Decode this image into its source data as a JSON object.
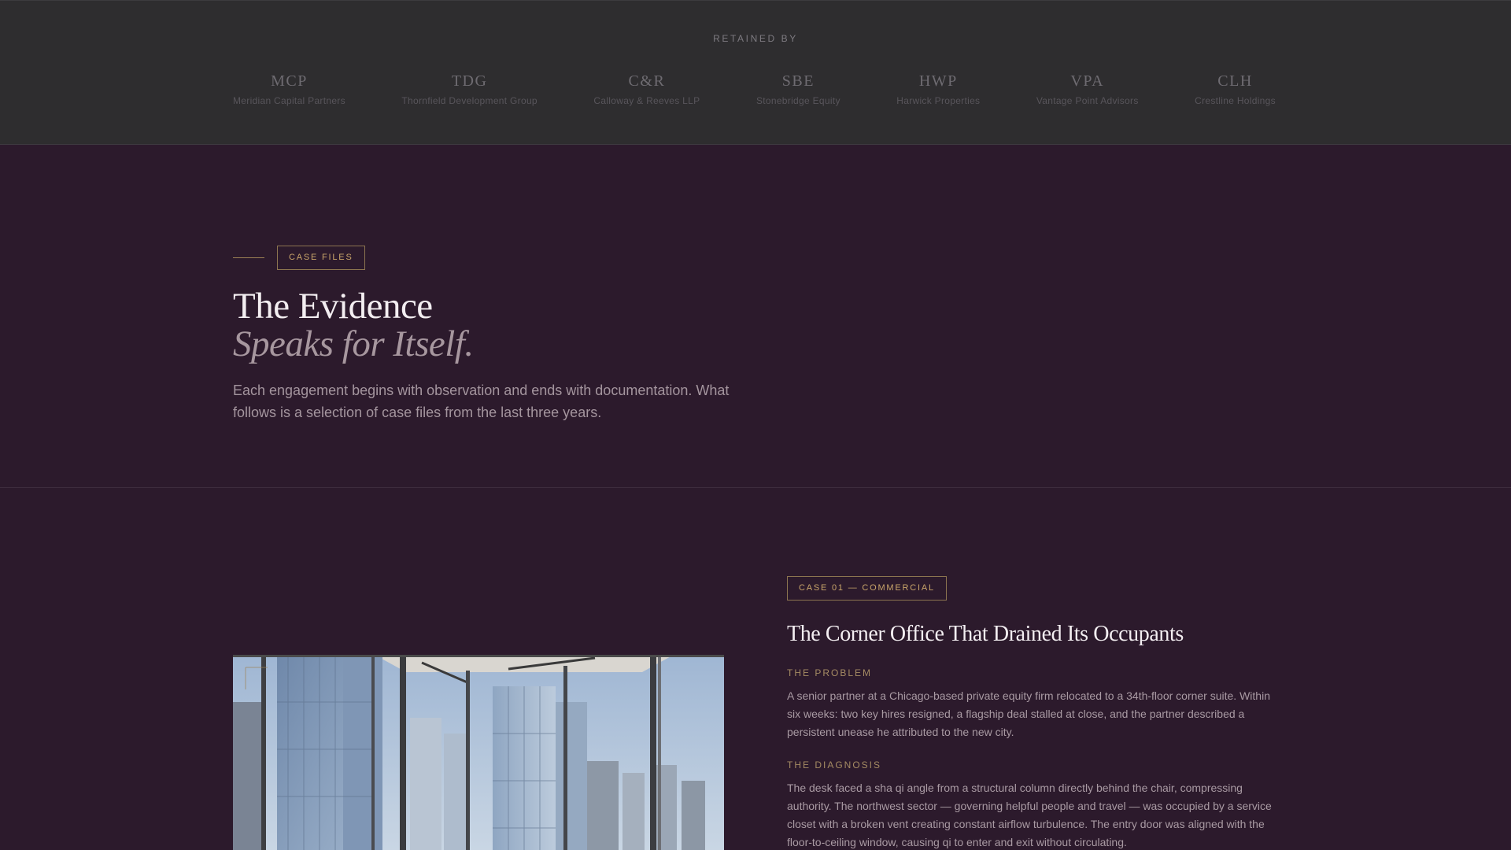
{
  "retained": {
    "label": "RETAINED BY",
    "clients": [
      {
        "abbr": "MCP",
        "name": "Meridian Capital Partners"
      },
      {
        "abbr": "TDG",
        "name": "Thornfield Development Group"
      },
      {
        "abbr": "C&R",
        "name": "Calloway & Reeves LLP"
      },
      {
        "abbr": "SBE",
        "name": "Stonebridge Equity"
      },
      {
        "abbr": "HWP",
        "name": "Harwick Properties"
      },
      {
        "abbr": "VPA",
        "name": "Vantage Point Advisors"
      },
      {
        "abbr": "CLH",
        "name": "Crestline Holdings"
      }
    ]
  },
  "intro": {
    "tag": "CASE FILES",
    "title": "The Evidence",
    "subtitle": "Speaks for Itself.",
    "description": "Each engagement begins with observation and ends with documentation. What follows is a selection of case files from the last three years."
  },
  "case01": {
    "tag": "CASE 01 — COMMERCIAL",
    "title": "The Corner Office That Drained Its Occupants",
    "problem_label": "THE PROBLEM",
    "problem_text": "A senior partner at a Chicago-based private equity firm relocated to a 34th-floor corner suite. Within six weeks: two key hires resigned, a flagship deal stalled at close, and the partner described a persistent unease he attributed to the new city.",
    "diagnosis_label": "THE DIAGNOSIS",
    "diagnosis_text": "The desk faced a sha qi angle from a structural column directly behind the chair, compressing authority. The northwest sector — governing helpful people and travel — was occupied by a service closet with a broken vent creating constant airflow turbulence. The entry door was aligned with the floor-to-ceiling window, causing qi to enter and exit without circulating."
  },
  "colors": {
    "background": "#2c1a2c",
    "strip": "#2e2d2f",
    "accent": "#c9a56a"
  }
}
